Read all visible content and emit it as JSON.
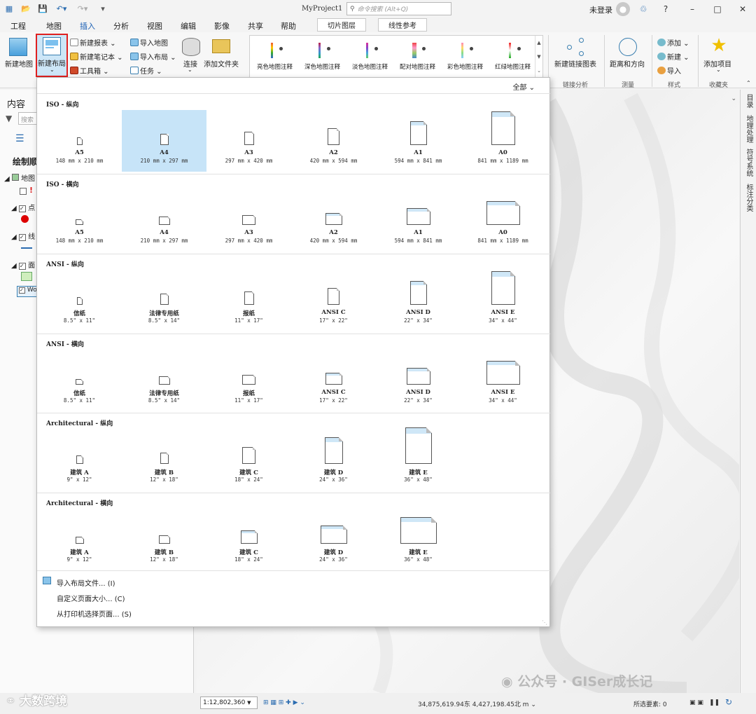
{
  "titlebar": {
    "project": "MyProject1",
    "search_placeholder": "命令搜索 (Alt+Q)",
    "user": "未登录",
    "help": "?"
  },
  "menu": {
    "tabs": [
      "工程",
      "地图",
      "插入",
      "分析",
      "视图",
      "编辑",
      "影像",
      "共享",
      "帮助"
    ],
    "active": "插入",
    "context_tabs": [
      "切片图层",
      "线性参考"
    ]
  },
  "ribbon": {
    "new_map": "新建地图",
    "new_layout": "新建布局",
    "new_report": "新建报表",
    "new_notebook": "新建笔记本",
    "toolbox": "工具箱",
    "import_map": "导入地图",
    "import_layout": "导入布局",
    "task": "任务",
    "connect": "连接",
    "add_folder": "添加文件夹",
    "gallery": [
      "亮色地图注释",
      "深色地图注释",
      "淡色地图注释",
      "配对地图注释",
      "彩色地图注释",
      "红绿地图注释"
    ],
    "new_link_chart": "新建链接图表",
    "distance_direction": "距离和方向",
    "add": "添加",
    "new": "新建",
    "import": "导入",
    "add_item": "添加项目",
    "group_link_analysis": "链接分析",
    "group_measure": "测量",
    "group_style": "样式",
    "group_favorites": "收藏夹"
  },
  "contents": {
    "title": "内容",
    "search_placeholder": "搜索",
    "drawing_order": "绘制顺",
    "rows": [
      "地图",
      "点",
      "线",
      "面",
      "Wo"
    ]
  },
  "right_dock": [
    "目录",
    "地理处理",
    "符号系统",
    "标注分类"
  ],
  "dropdown": {
    "filter": "全部",
    "sections": [
      {
        "title": "ISO - 纵向",
        "items": [
          {
            "name": "A5",
            "size": "148 mm x 210 mm"
          },
          {
            "name": "A4",
            "size": "210 mm x 297 mm"
          },
          {
            "name": "A3",
            "size": "297 mm x 420 mm"
          },
          {
            "name": "A2",
            "size": "420 mm x 594 mm"
          },
          {
            "name": "A1",
            "size": "594 mm x 841 mm"
          },
          {
            "name": "A0",
            "size": "841 mm x 1189 mm"
          }
        ]
      },
      {
        "title": "ISO - 横向",
        "items": [
          {
            "name": "A5",
            "size": "148 mm x 210 mm"
          },
          {
            "name": "A4",
            "size": "210 mm x 297 mm"
          },
          {
            "name": "A3",
            "size": "297 mm x 420 mm"
          },
          {
            "name": "A2",
            "size": "420 mm x 594 mm"
          },
          {
            "name": "A1",
            "size": "594 mm x 841 mm"
          },
          {
            "name": "A0",
            "size": "841 mm x 1189 mm"
          }
        ]
      },
      {
        "title": "ANSI - 纵向",
        "items": [
          {
            "name": "信纸",
            "size": "8.5\" x 11\""
          },
          {
            "name": "法律专用纸",
            "size": "8.5\" x 14\""
          },
          {
            "name": "报纸",
            "size": "11\" x 17\""
          },
          {
            "name": "ANSI C",
            "size": "17\" x 22\""
          },
          {
            "name": "ANSI D",
            "size": "22\" x 34\""
          },
          {
            "name": "ANSI E",
            "size": "34\" x 44\""
          }
        ]
      },
      {
        "title": "ANSI - 横向",
        "items": [
          {
            "name": "信纸",
            "size": "8.5\" x 11\""
          },
          {
            "name": "法律专用纸",
            "size": "8.5\" x 14\""
          },
          {
            "name": "报纸",
            "size": "11\" x 17\""
          },
          {
            "name": "ANSI C",
            "size": "17\" x 22\""
          },
          {
            "name": "ANSI D",
            "size": "22\" x 34\""
          },
          {
            "name": "ANSI E",
            "size": "34\" x 44\""
          }
        ]
      },
      {
        "title": "Architectural - 纵向",
        "items": [
          {
            "name": "建筑 A",
            "size": "9\" x 12\""
          },
          {
            "name": "建筑 B",
            "size": "12\" x 18\""
          },
          {
            "name": "建筑 C",
            "size": "18\" x 24\""
          },
          {
            "name": "建筑 D",
            "size": "24\" x 36\""
          },
          {
            "name": "建筑 E",
            "size": "36\" x 48\""
          }
        ]
      },
      {
        "title": "Architectural - 横向",
        "items": [
          {
            "name": "建筑 A",
            "size": "9\" x 12\""
          },
          {
            "name": "建筑 B",
            "size": "12\" x 18\""
          },
          {
            "name": "建筑 C",
            "size": "18\" x 24\""
          },
          {
            "name": "建筑 D",
            "size": "24\" x 36\""
          },
          {
            "name": "建筑 E",
            "size": "36\" x 48\""
          }
        ]
      }
    ],
    "selected": "A4",
    "footer": [
      "导入布局文件... (I)",
      "自定义页面大小... (C)",
      "从打印机选择页面... (S)"
    ]
  },
  "status": {
    "scale": "1:12,802,360",
    "coords": "34,875,619.94东 4,427,198.45北 m",
    "selected_features": "所选要素: 0"
  },
  "watermark": {
    "left": "大数跨境",
    "right": "公众号 · GISer成长记"
  },
  "colors": {
    "accent": "#1a5fb4",
    "selected_tile": "#c7e4f8",
    "highlight_border": "#e02020"
  }
}
